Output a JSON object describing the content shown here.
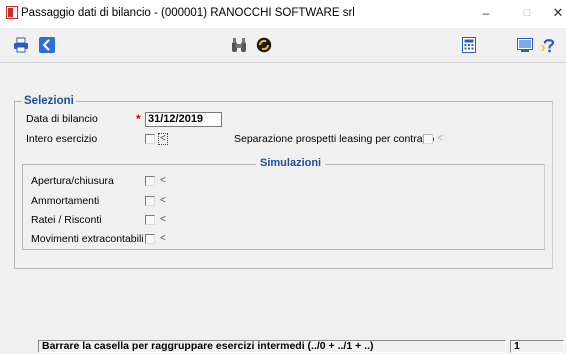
{
  "window": {
    "title": "Passaggio dati di bilancio  -  (000001) RANOCCHI SOFTWARE srl",
    "minimize_glyph": "–",
    "maximize_glyph": "□",
    "close_glyph": "✕"
  },
  "toolbar": {
    "icons": [
      "printer-icon",
      "back-arrow-icon",
      "binoculars-icon",
      "globe-icon",
      "calculator-icon",
      "monitor-icon",
      "help-icon"
    ],
    "accent": "#2b6fd6"
  },
  "selezioni": {
    "title": "Selezioni",
    "data_label": "Data di bilancio",
    "required_mark": "*",
    "data_value": "31/12/2019",
    "intero_label": "Intero esercizio",
    "intero_arrow": "<",
    "leasing_label": "Separazione prospetti leasing per contratto",
    "leasing_arrow": "<"
  },
  "simulazioni": {
    "title": "Simulazioni",
    "items": [
      {
        "label": "Apertura/chiusura",
        "arrow": "<"
      },
      {
        "label": "Ammortamenti",
        "arrow": "<"
      },
      {
        "label": "Ratei / Risconti",
        "arrow": "<"
      },
      {
        "label": "Movimenti extracontabili",
        "arrow": "<"
      }
    ]
  },
  "status": {
    "message": "Barrare la casella per raggruppare esercizi intermedi (../0 + ../1 + ..)",
    "page": "1"
  }
}
